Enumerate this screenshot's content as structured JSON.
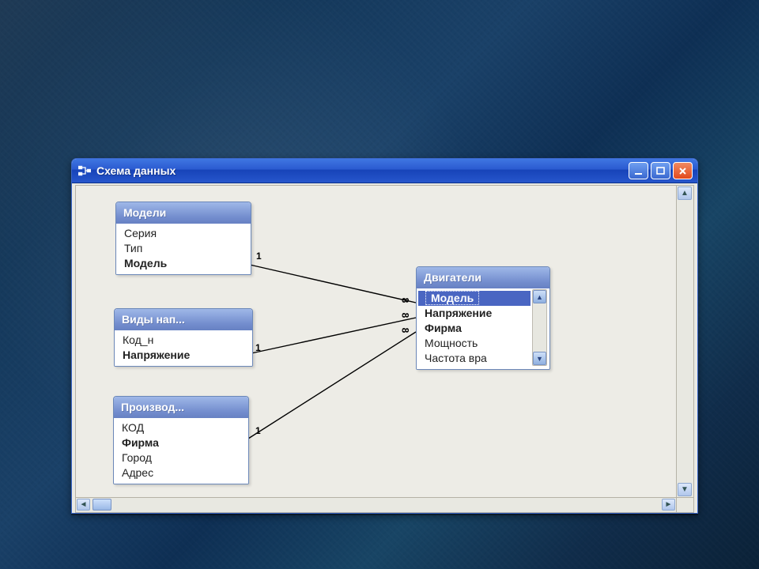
{
  "window": {
    "title": "Схема данных"
  },
  "tables": {
    "models": {
      "title": "Модели",
      "fields": [
        "Серия",
        "Тип",
        "Модель"
      ],
      "keys": [
        "Модель"
      ]
    },
    "voltages": {
      "title": "Виды нап...",
      "fields": [
        "Код_н",
        "Напряжение"
      ],
      "keys": [
        "Напряжение"
      ]
    },
    "producers": {
      "title": "Производ...",
      "fields": [
        "КОД",
        "Фирма",
        "Город",
        "Адрес"
      ],
      "keys": [
        "Фирма"
      ]
    },
    "engines": {
      "title": "Двигатели",
      "fields": [
        "Модель",
        "Напряжение",
        "Фирма",
        "Мощность",
        "Частота вра"
      ],
      "keys": [
        "Модель",
        "Напряжение",
        "Фирма"
      ],
      "selected": "Модель"
    }
  },
  "relationships": [
    {
      "from": "models",
      "to": "engines",
      "from_card": "1",
      "to_card": "∞"
    },
    {
      "from": "voltages",
      "to": "engines",
      "from_card": "1",
      "to_card": "∞"
    },
    {
      "from": "producers",
      "to": "engines",
      "from_card": "1",
      "to_card": "∞"
    }
  ],
  "cardinality": {
    "one": "1",
    "many": "∞"
  }
}
